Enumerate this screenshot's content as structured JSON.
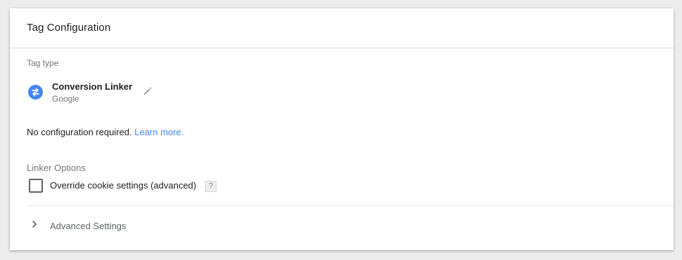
{
  "card": {
    "title": "Tag Configuration"
  },
  "tag_type": {
    "section_label": "Tag type",
    "icon": "swap-arrows-icon",
    "name": "Conversion Linker",
    "vendor": "Google",
    "edit_icon": "pencil-icon"
  },
  "config": {
    "message": "No configuration required.",
    "learn_more": "Learn more."
  },
  "linker_options": {
    "section_label": "Linker Options",
    "override_label": "Override cookie settings (advanced)",
    "override_checked": false,
    "help_glyph": "?"
  },
  "advanced": {
    "label": "Advanced Settings",
    "icon": "chevron-right-icon"
  },
  "colors": {
    "accent": "#4285f4",
    "background": "#ececec",
    "card": "#ffffff"
  }
}
